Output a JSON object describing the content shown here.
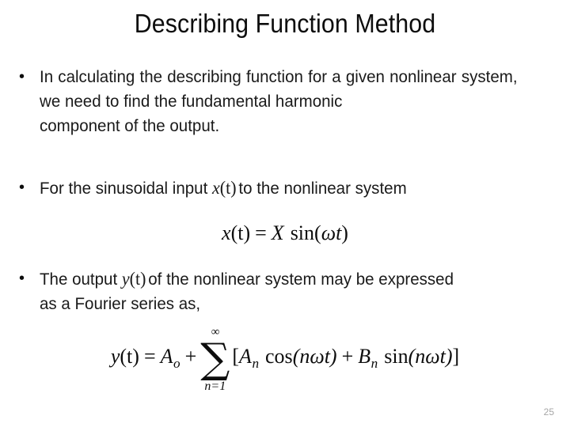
{
  "slide": {
    "title": "Describing Function Method",
    "page_number": "25",
    "background_color": "#ffffff",
    "text_color": "#1a1a1a",
    "page_number_color": "#a6a6a6"
  },
  "bullets": [
    {
      "marker": "•",
      "text_full": "In calculating the describing function for a given nonlinear system, we need to find the fundamental harmonic component of the output.",
      "line1": "In calculating the describing function for a given nonlinear",
      "line2": "system, we need to find the fundamental harmonic",
      "line3": "component of the output."
    },
    {
      "marker": "•",
      "text_before_math": "For the sinusoidal input",
      "inline_math_var": "x",
      "inline_math_arg": "(t)",
      "text_after_math": "to the nonlinear system"
    },
    {
      "marker": "•",
      "text_before_math": "The output",
      "inline_math_var": "y",
      "inline_math_arg": "(t)",
      "text_after_math": "of the nonlinear system may be expressed",
      "line2": "as a Fourier series as,"
    }
  ],
  "equations": [
    {
      "id": "equation-1",
      "latex": "x(t) = X \\sin(\\omega t)",
      "lhs_var": "x",
      "lhs_arg": "(t)",
      "equals": "=",
      "amplitude": "X",
      "func": "sin",
      "open_paren": "(",
      "omega": "ω",
      "time_var": "t",
      "close_paren": ")"
    },
    {
      "id": "equation-2",
      "latex": "y(t) = A_o + \\sum_{n=1}^{\\infty}\\left[A_n \\cos(n\\omega t) + B_n \\sin(n\\omega t)\\right]",
      "lhs_var": "y",
      "lhs_arg": "(t)",
      "equals": "=",
      "dc_term": "A",
      "dc_sub": "o",
      "plus": "+",
      "sum_glyph": "∑",
      "sum_upper": "∞",
      "sum_lower": "n=1",
      "open_bracket": "[",
      "cos_coeff": "A",
      "cos_sub": "n",
      "cos_func": "cos",
      "cos_arg": "(nωt)",
      "inner_plus": "+",
      "sin_coeff": "B",
      "sin_sub": "n",
      "sin_func": "sin",
      "sin_arg": "(nωt)",
      "close_bracket": "]"
    }
  ]
}
